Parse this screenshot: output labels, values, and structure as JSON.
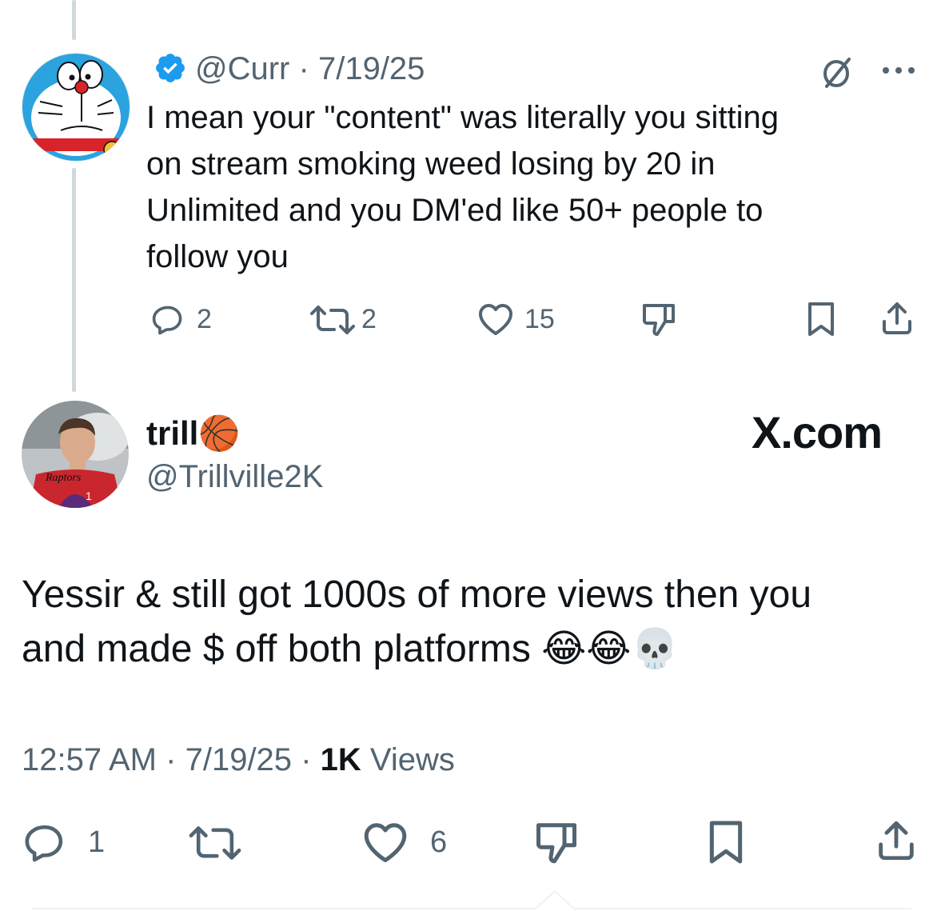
{
  "parent_tweet": {
    "handle": "@Curr",
    "separator": "·",
    "date": "7/19/25",
    "verified": true,
    "text": "I mean your \"content\" was literally you sitting on stream smoking weed losing by 20 in Unlimited and you DM'ed like 50+ people to follow you",
    "text_lines": [
      "I mean your \"content\" was literally you sitting",
      "on stream smoking weed losing by 20 in",
      "Unlimited and you DM'ed like 50+ people to",
      "follow you"
    ],
    "actions": {
      "replies": "2",
      "reposts": "2",
      "likes": "15"
    }
  },
  "main_tweet": {
    "display_name": "trill",
    "name_emoji": "🏀",
    "handle": "@Trillville2K",
    "avatar_jersey_text": "Raptors",
    "avatar_jersey_number": "1",
    "watermark": "X.com",
    "text_lines": [
      "Yessir & still got 1000s of more views then you",
      "and made $ off both platforms"
    ],
    "emojis": [
      "😂",
      "😂",
      "💀"
    ],
    "time": "12:57 AM",
    "separator": "·",
    "date": "7/19/25",
    "views_count": "1K",
    "views_label": "Views",
    "actions": {
      "replies": "1",
      "likes": "6"
    }
  },
  "colors": {
    "verified_blue": "#1d9bf0",
    "icon_gray": "#536471",
    "thread_line": "#cfd9de",
    "text": "#0f1419"
  }
}
